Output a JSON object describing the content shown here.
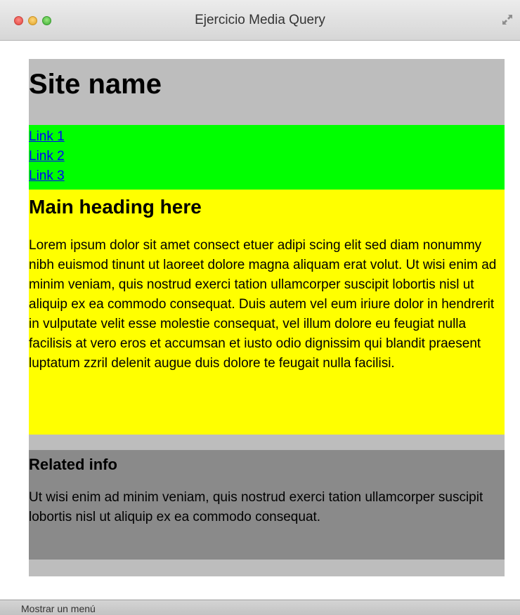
{
  "window": {
    "title": "Ejercicio Media Query"
  },
  "header": {
    "site_name": "Site name"
  },
  "nav": {
    "links": [
      "Link 1",
      "Link 2",
      "Link 3"
    ]
  },
  "main": {
    "heading": "Main heading here",
    "body": "Lorem ipsum dolor sit amet consect etuer adipi scing elit sed diam nonummy nibh euismod tinunt ut laoreet dolore magna aliquam erat volut. Ut wisi enim ad minim veniam, quis nostrud exerci tation ullamcorper suscipit lobortis nisl ut aliquip ex ea commodo consequat. Duis autem vel eum iriure dolor in hendrerit in vulputate velit esse molestie consequat, vel illum dolore eu feugiat nulla facilisis at vero eros et accumsan et iusto odio dignissim qui blandit praesent luptatum zzril delenit augue duis dolore te feugait nulla facilisi."
  },
  "aside": {
    "heading": "Related info",
    "body": "Ut wisi enim ad minim veniam, quis nostrud exerci tation ullamcorper suscipit lobortis nisl ut aliquip ex ea commodo consequat."
  },
  "statusbar": {
    "text": "Mostrar un menú"
  },
  "colors": {
    "header_bg": "#bdbdbd",
    "nav_bg": "#00ff00",
    "main_bg": "#ffff00",
    "aside_bg": "#8a8a8a",
    "link": "#0000ff"
  },
  "icons": {
    "close": "close-button-red",
    "minimize": "minimize-button-yellow",
    "maximize": "zoom-button-green",
    "fullscreen": "fullscreen-arrows-icon"
  }
}
